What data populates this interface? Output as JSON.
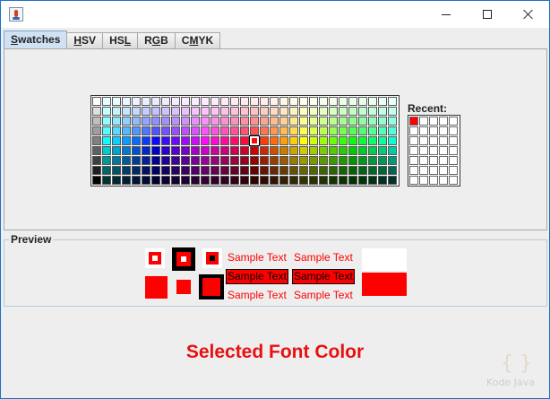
{
  "window": {
    "title": ""
  },
  "tabs": [
    {
      "label": "Swatches",
      "mnemonic_index": 0,
      "active": true
    },
    {
      "label": "HSV",
      "mnemonic_index": 0,
      "active": false
    },
    {
      "label": "HSL",
      "mnemonic_index": 2,
      "active": false
    },
    {
      "label": "RGB",
      "mnemonic_index": 1,
      "active": false
    },
    {
      "label": "CMYK",
      "mnemonic_index": 1,
      "active": false
    }
  ],
  "swatches": {
    "columns": 31,
    "rows": 9,
    "selected": {
      "row": 4,
      "col": 16
    }
  },
  "recent": {
    "label": "Recent:",
    "columns": 5,
    "rows": 7,
    "colors": [
      "#ff0000"
    ]
  },
  "preview": {
    "legend": "Preview",
    "sample_text": "Sample Text",
    "color": "#ff0000"
  },
  "footer": {
    "selected_label": "Selected Font Color",
    "label_color": "#e81010"
  },
  "watermark": {
    "text": "Kode Java",
    "glyph": "{ }"
  }
}
